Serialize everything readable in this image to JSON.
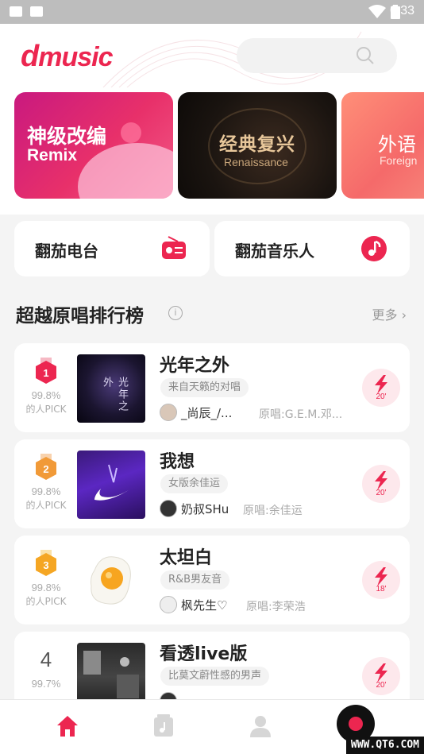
{
  "status_bar": {
    "time": "6:33"
  },
  "header": {
    "logo": "music",
    "logo_mark": "d"
  },
  "banners": [
    {
      "title": "神级改编",
      "subtitle": "Remix"
    },
    {
      "title": "经典复兴",
      "subtitle": "Renaissance"
    },
    {
      "title": "外语",
      "subtitle": "Foreign"
    }
  ],
  "quick_entries": [
    {
      "label": "翻茄电台",
      "icon": "radio-icon"
    },
    {
      "label": "翻茄音乐人",
      "icon": "music-note-icon"
    }
  ],
  "section": {
    "title": "超越原唱排行榜",
    "more": "更多"
  },
  "songs": [
    {
      "rank": "1",
      "pct": "99.8%",
      "pick": "的人PICK",
      "title": "光年之外",
      "tag": "来自天籁的对唱",
      "singer": "_尚辰_/...",
      "original": "原唱:G.E.M.邓...",
      "duration": "20'",
      "cover_text": "光年之外"
    },
    {
      "rank": "2",
      "pct": "99.8%",
      "pick": "的人PICK",
      "title": "我想",
      "tag": "女版余佳运",
      "singer": "奶叔SHu",
      "original": "原唱:余佳运",
      "duration": "20'"
    },
    {
      "rank": "3",
      "pct": "99.8%",
      "pick": "的人PICK",
      "title": "太坦白",
      "tag": "R&B男友音",
      "singer": "枫先生♡",
      "original": "原唱:李荣浩",
      "duration": "18'"
    },
    {
      "rank": "4",
      "pct": "99.7%",
      "pick": "",
      "title": "看透live版",
      "tag": "比莫文蔚性感的男声",
      "singer": "",
      "original": "",
      "duration": "20'"
    }
  ],
  "watermark": "WWW.QT6.COM",
  "colors": {
    "accent": "#ec2650",
    "gold": "#f19a38"
  }
}
